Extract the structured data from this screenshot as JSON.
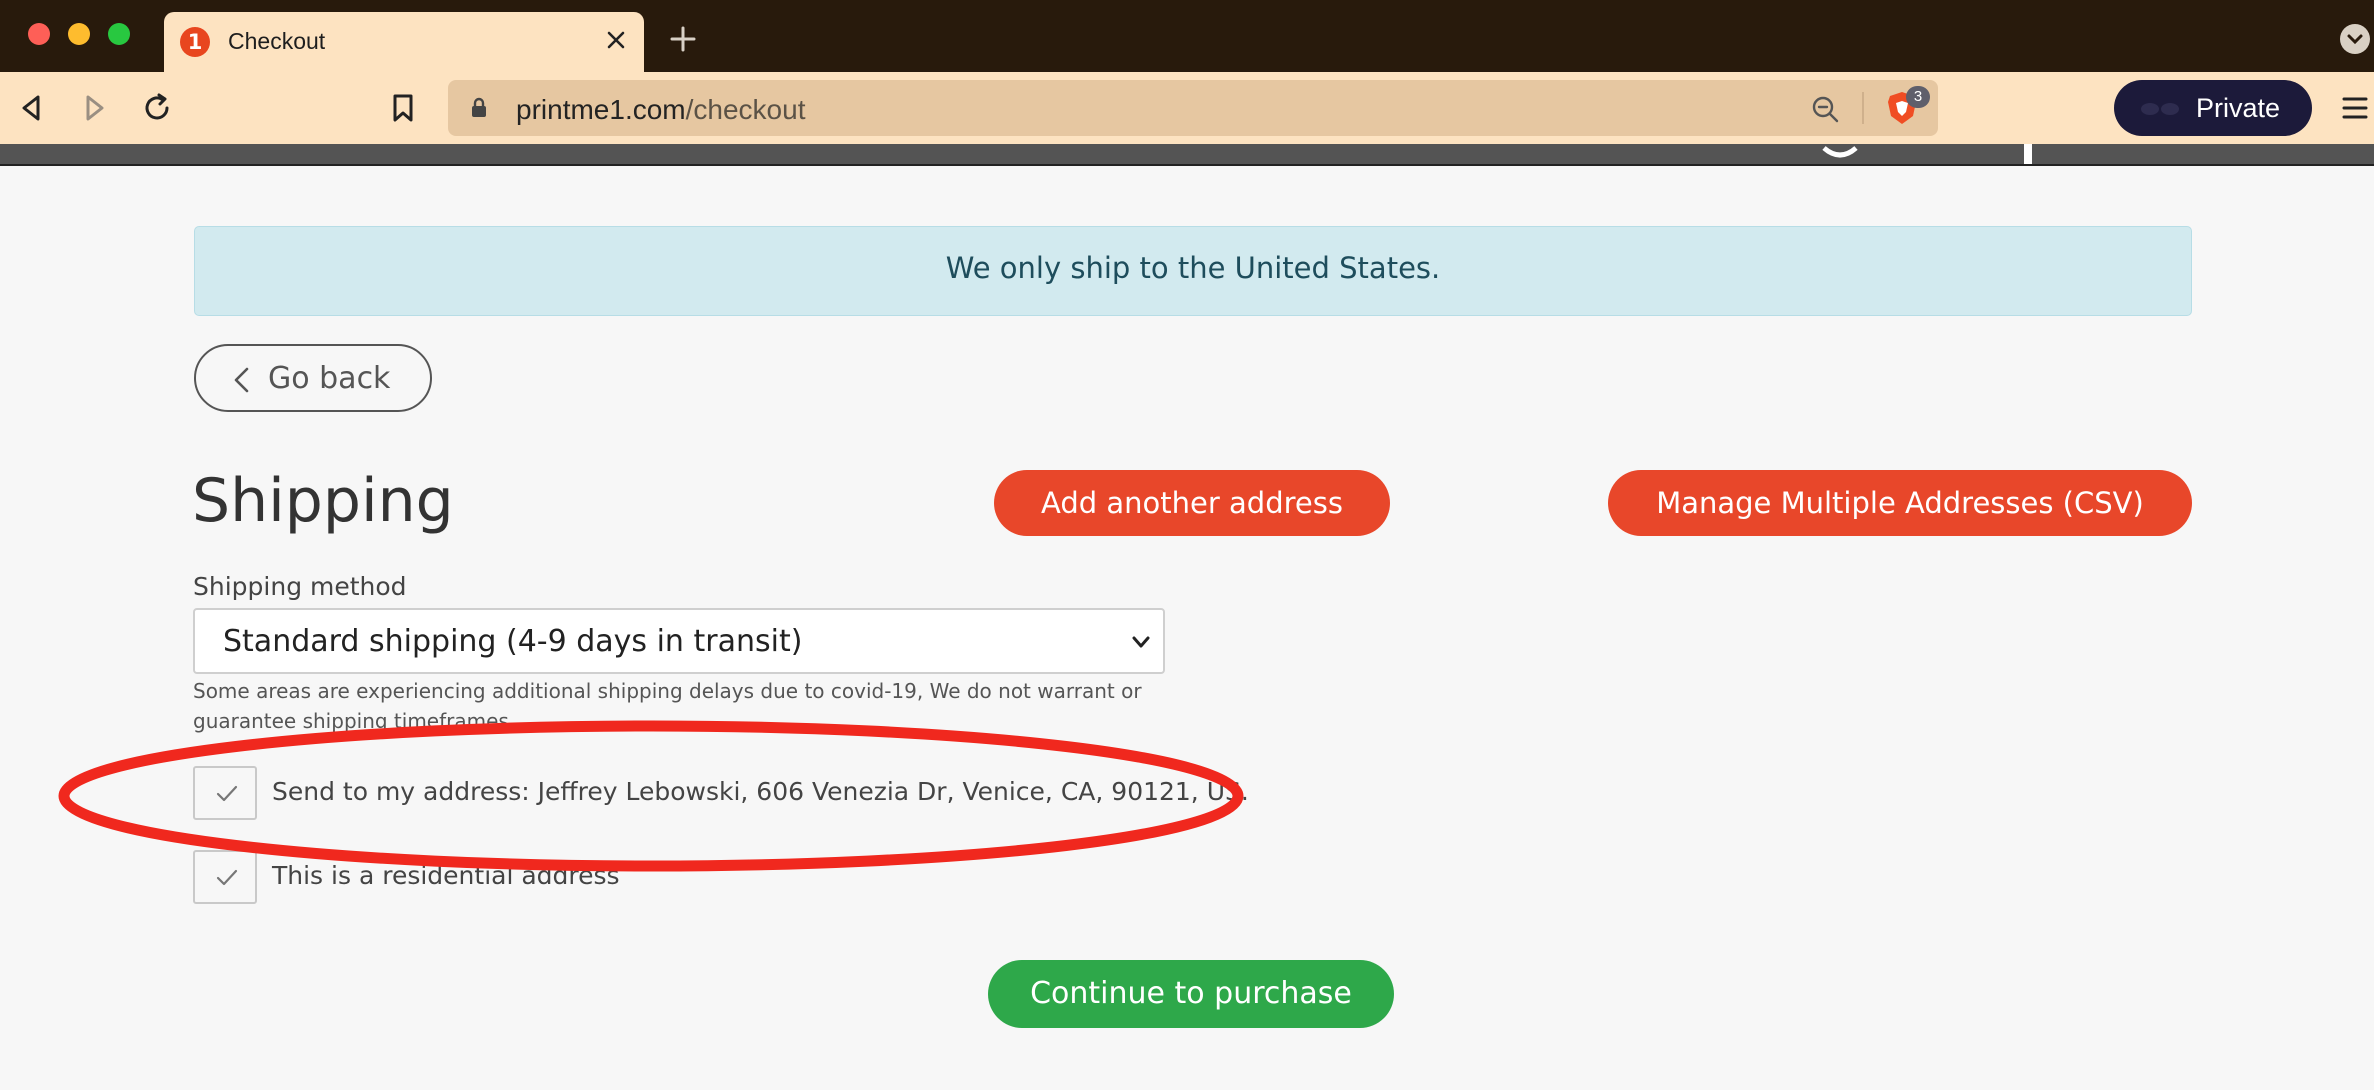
{
  "browser": {
    "tab": {
      "title": "Checkout",
      "favicon_text": "1"
    },
    "address": {
      "domain": "printme1.com",
      "path": "/checkout"
    },
    "shields_count": "3",
    "private_label": "Private"
  },
  "page": {
    "notice": "We only ship to the United States.",
    "go_back_label": "Go back",
    "heading": "Shipping",
    "add_address_label": "Add another address",
    "manage_csv_label": "Manage Multiple Addresses (CSV)",
    "shipping_method_label": "Shipping method",
    "shipping_method_value": "Standard shipping (4-9 days in transit)",
    "shipping_help": "Some areas are experiencing additional shipping delays due to covid-19, We do not warrant or guarantee shipping timeframes.",
    "send_to_my_address": "Send to my address: Jeffrey Lebowski, 606 Venezia Dr, Venice, CA, 90121, US.",
    "residential_label": "This is a residential address",
    "continue_label": "Continue to purchase"
  },
  "colors": {
    "accent_red": "#e8472a",
    "accent_green": "#2ea84a",
    "notice_bg": "#d2eaef",
    "annotation": "#f0281e"
  }
}
